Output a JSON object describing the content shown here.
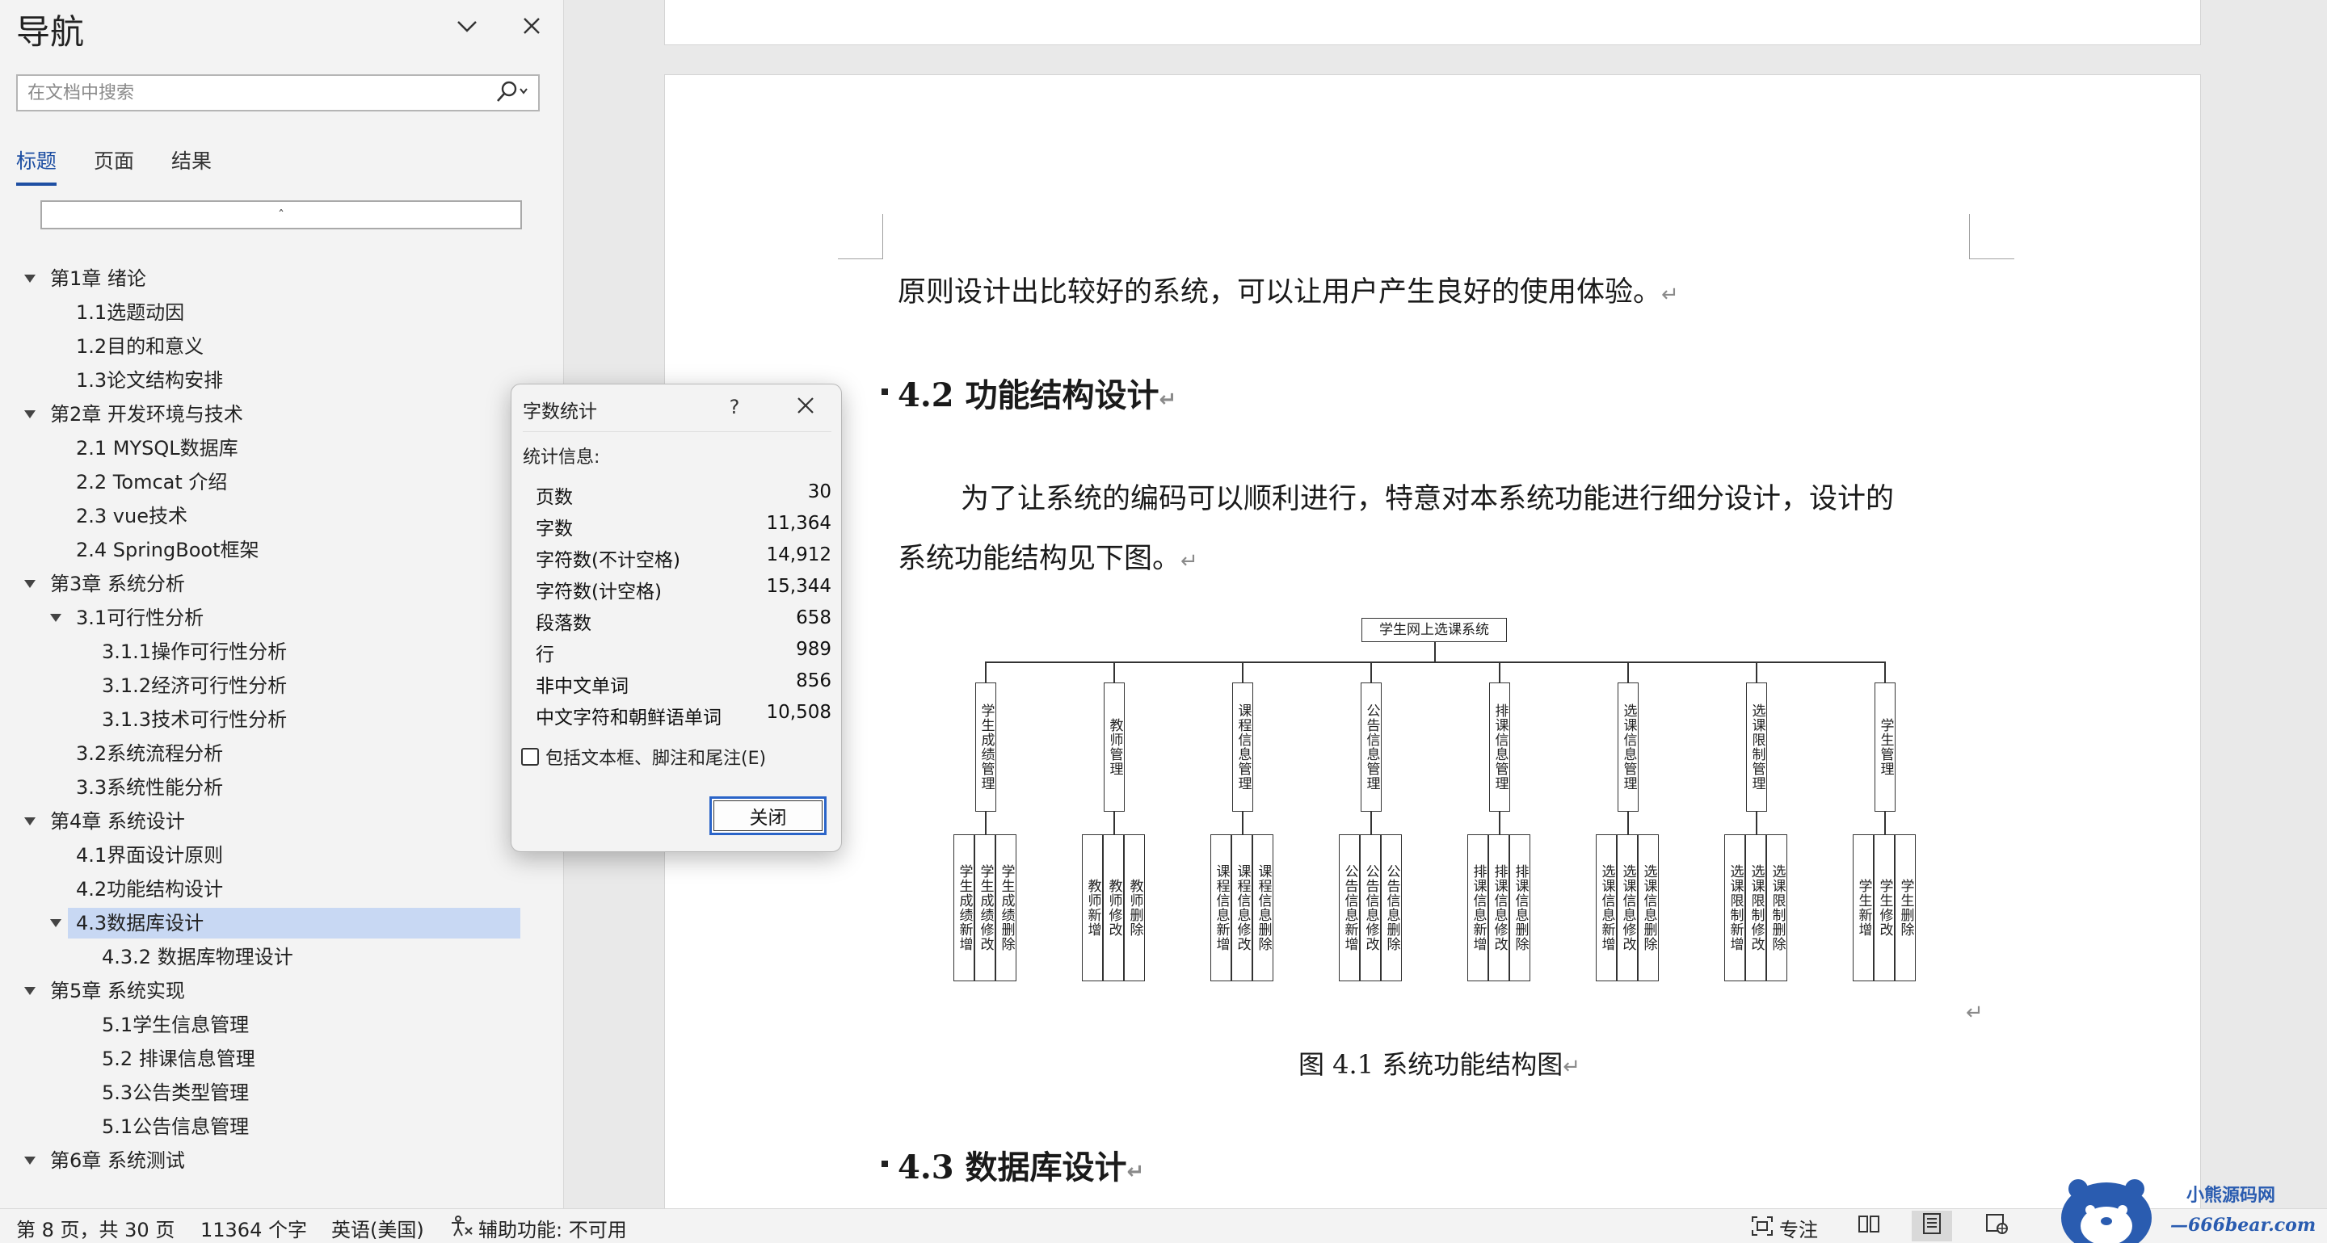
{
  "nav": {
    "title": "导航",
    "search_placeholder": "在文档中搜索",
    "tabs": [
      "标题",
      "页面",
      "结果"
    ],
    "scroll_marker": "ˆ",
    "items": [
      {
        "label": "第1章 绪论",
        "level": 1,
        "expanded": true
      },
      {
        "label": "1.1选题动因",
        "level": 2
      },
      {
        "label": "1.2目的和意义",
        "level": 2
      },
      {
        "label": "1.3论文结构安排",
        "level": 2
      },
      {
        "label": "第2章 开发环境与技术",
        "level": 1,
        "expanded": true
      },
      {
        "label": "2.1 MYSQL数据库",
        "level": 2
      },
      {
        "label": "2.2 Tomcat 介绍",
        "level": 2
      },
      {
        "label": "2.3 vue技术",
        "level": 2
      },
      {
        "label": "2.4 SpringBoot框架",
        "level": 2
      },
      {
        "label": "第3章 系统分析",
        "level": 1,
        "expanded": true
      },
      {
        "label": "3.1可行性分析",
        "level": 2,
        "expanded": true
      },
      {
        "label": "3.1.1操作可行性分析",
        "level": 3
      },
      {
        "label": "3.1.2经济可行性分析",
        "level": 3
      },
      {
        "label": "3.1.3技术可行性分析",
        "level": 3
      },
      {
        "label": "3.2系统流程分析",
        "level": 2
      },
      {
        "label": "3.3系统性能分析",
        "level": 2
      },
      {
        "label": "第4章 系统设计",
        "level": 1,
        "expanded": true
      },
      {
        "label": "4.1界面设计原则",
        "level": 2
      },
      {
        "label": "4.2功能结构设计",
        "level": 2
      },
      {
        "label": "4.3数据库设计",
        "level": 2,
        "expanded": true,
        "selected": true
      },
      {
        "label": "4.3.2 数据库物理设计",
        "level": 3
      },
      {
        "label": "第5章 系统实现",
        "level": 1,
        "expanded": true
      },
      {
        "label": "5.1学生信息管理",
        "level": 3
      },
      {
        "label": "5.2 排课信息管理",
        "level": 3
      },
      {
        "label": "5.3公告类型管理",
        "level": 3
      },
      {
        "label": "5.1公告信息管理",
        "level": 3
      },
      {
        "label": "第6章 系统测试",
        "level": 1,
        "expanded": true
      }
    ]
  },
  "document": {
    "line1": "原则设计出比较好的系统，可以让用户产生良好的使用体验。",
    "heading1": "4.2 功能结构设计",
    "para1": "为了让系统的编码可以顺利进行，特意对本系统功能进行细分设计，设计的",
    "para2": "系统功能结构见下图。",
    "caption": "图 4.1  系统功能结构图",
    "heading2": "4.3 数据库设计",
    "pilcrow": "↵"
  },
  "diagram": {
    "root": "学生网上选课系统",
    "modules": [
      {
        "name": "学生成绩管理",
        "children": [
          "学生成绩新增",
          "学生成绩修改",
          "学生成绩删除"
        ]
      },
      {
        "name": "教师管理",
        "children": [
          "教师新增",
          "教师修改",
          "教师删除"
        ]
      },
      {
        "name": "课程信息管理",
        "children": [
          "课程信息新增",
          "课程信息修改",
          "课程信息删除"
        ]
      },
      {
        "name": "公告信息管理",
        "children": [
          "公告信息新增",
          "公告信息修改",
          "公告信息删除"
        ]
      },
      {
        "name": "排课信息管理",
        "children": [
          "排课信息新增",
          "排课信息修改",
          "排课信息删除"
        ]
      },
      {
        "name": "选课信息管理",
        "children": [
          "选课信息新增",
          "选课信息修改",
          "选课信息删除"
        ]
      },
      {
        "name": "选课限制管理",
        "children": [
          "选课限制新增",
          "选课限制修改",
          "选课限制删除"
        ]
      },
      {
        "name": "学生管理",
        "children": [
          "学生新增",
          "学生修改",
          "学生删除"
        ]
      }
    ]
  },
  "dialog": {
    "title": "字数统计",
    "help": "?",
    "section": "统计信息:",
    "stats": [
      {
        "label": "页数",
        "value": "30"
      },
      {
        "label": "字数",
        "value": "11,364"
      },
      {
        "label": "字符数(不计空格)",
        "value": "14,912"
      },
      {
        "label": "字符数(计空格)",
        "value": "15,344"
      },
      {
        "label": "段落数",
        "value": "658"
      },
      {
        "label": "行",
        "value": "989"
      },
      {
        "label": "非中文单词",
        "value": "856"
      },
      {
        "label": "中文字符和朝鲜语单词",
        "value": "10,508"
      }
    ],
    "checkbox_label": "包括文本框、脚注和尾注(E)",
    "checkbox_checked": false,
    "close_label": "关闭"
  },
  "status": {
    "page": "第 8 页，共 30 页",
    "words": "11364 个字",
    "language": "英语(美国)",
    "accessibility": "辅助功能: 不可用",
    "focus": "专注"
  },
  "watermark": {
    "title": "小熊源码网",
    "url": "—666bear.com—"
  }
}
